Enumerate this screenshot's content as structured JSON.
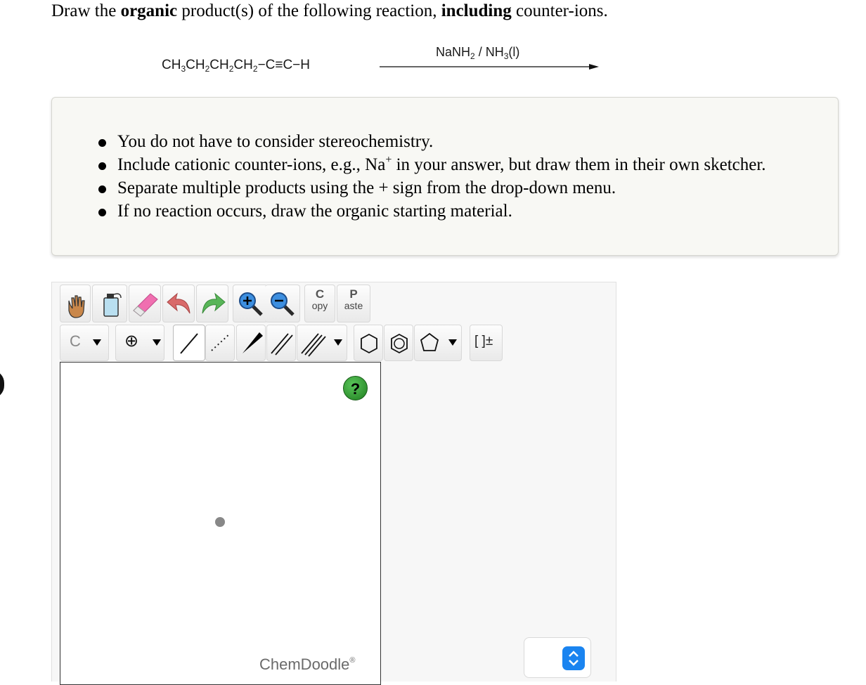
{
  "question": {
    "part1": "Draw the ",
    "bold1": "organic",
    "part2": " product(s) of the following reaction, ",
    "bold2": "including",
    "part3": " counter-ions."
  },
  "reaction": {
    "reactant_parts": [
      "CH",
      "3",
      "CH",
      "2",
      "CH",
      "2",
      "CH",
      "2",
      "−C≡C−H"
    ],
    "reagent_parts": [
      "NaNH",
      "2",
      " / NH",
      "3",
      "(l)"
    ]
  },
  "hints": {
    "item1": "You do not have to consider stereochemistry.",
    "item2_a": "Include cationic counter-ions, e.g., Na",
    "item2_sup": "+",
    "item2_b": " in your answer, but draw them in their own sketcher.",
    "item3": "Separate multiple products using the + sign from the drop-down menu.",
    "item4": "If no reaction occurs, draw the organic starting material."
  },
  "toolbar": {
    "copy_top": "C",
    "copy_bottom": "opy",
    "paste_top": "P",
    "paste_bottom": "aste",
    "atom_label": "C",
    "charge_label": "⊕",
    "bracket_label": "[ ]±"
  },
  "canvas": {
    "help_label": "?",
    "brand": "ChemDoodle",
    "brand_mark": "®"
  },
  "colors": {
    "help_green": "#2e9e2e",
    "spinner_blue": "#1a84f0",
    "eraser_pink": "#f06fb0",
    "undo_red": "#d96a6a",
    "redo_green": "#58b558"
  },
  "icons": [
    "hand-icon",
    "erase-all-icon",
    "eraser-icon",
    "undo-icon",
    "redo-icon",
    "zoom-in-icon",
    "zoom-out-icon",
    "copy-icon",
    "paste-icon",
    "carbon-atom-icon",
    "charge-icon",
    "single-bond-icon",
    "dashed-bond-icon",
    "wedge-bond-icon",
    "double-bond-icon",
    "triple-bond-icon",
    "cyclohexane-icon",
    "benzene-icon",
    "cyclopentane-icon",
    "bracket-icon",
    "help-icon",
    "spinner-icon"
  ]
}
